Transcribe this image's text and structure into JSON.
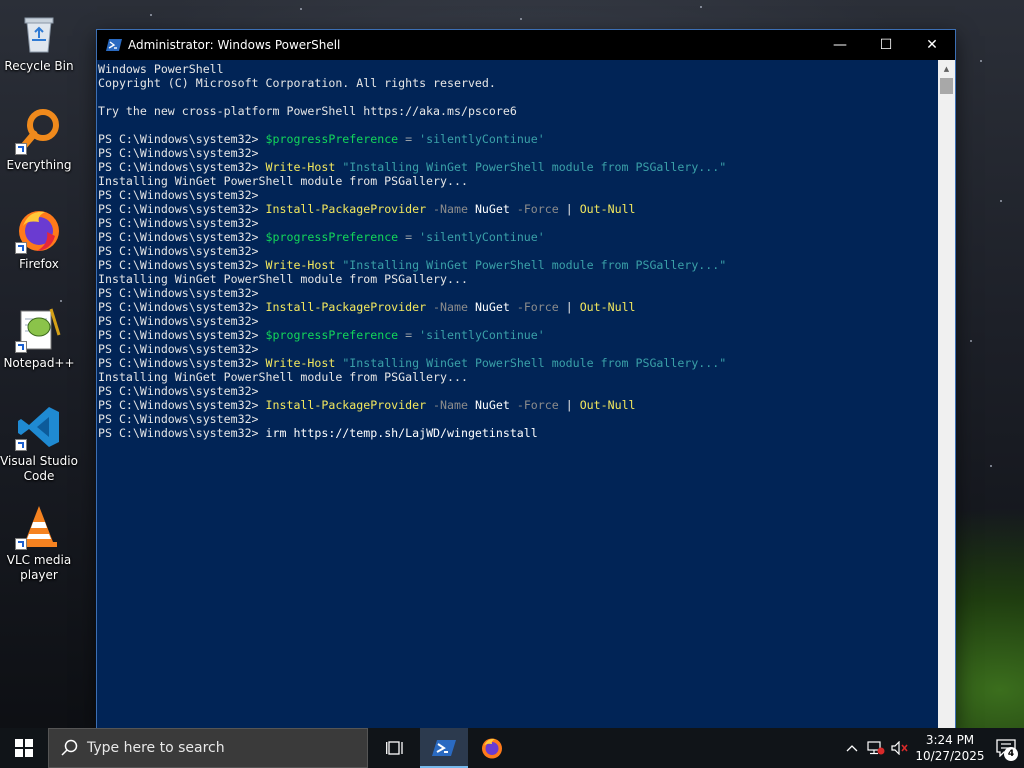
{
  "desktop": {
    "icons": [
      {
        "label": "Recycle Bin",
        "icon": "recycle-bin-icon"
      },
      {
        "label": "Everything",
        "icon": "everything-search-icon"
      },
      {
        "label": "Firefox",
        "icon": "firefox-icon"
      },
      {
        "label": "Notepad++",
        "icon": "notepad-plus-plus-icon"
      },
      {
        "label": "Visual Studio Code",
        "icon": "vscode-icon"
      },
      {
        "label": "VLC media player",
        "icon": "vlc-icon"
      }
    ]
  },
  "window": {
    "title": "Administrator: Windows PowerShell",
    "controls": {
      "minimize": "—",
      "maximize": "☐",
      "close": "✕"
    }
  },
  "console": {
    "lines": [
      [
        [
          "t",
          "Windows PowerShell"
        ]
      ],
      [
        [
          "t",
          "Copyright (C) Microsoft Corporation. All rights reserved."
        ]
      ],
      [],
      [
        [
          "t",
          "Try the new cross-platform PowerShell https://aka.ms/pscore6"
        ]
      ],
      [],
      [
        [
          "t",
          "PS C:\\Windows\\system32> "
        ],
        [
          "var",
          "$progressPreference"
        ],
        [
          "op",
          " = "
        ],
        [
          "str",
          "'silentlyContinue'"
        ]
      ],
      [
        [
          "t",
          "PS C:\\Windows\\system32>"
        ]
      ],
      [
        [
          "t",
          "PS C:\\Windows\\system32> "
        ],
        [
          "cmd",
          "Write-Host"
        ],
        [
          "str",
          " \"Installing WinGet PowerShell module from PSGallery...\""
        ]
      ],
      [
        [
          "t",
          "Installing WinGet PowerShell module from PSGallery..."
        ]
      ],
      [
        [
          "t",
          "PS C:\\Windows\\system32>"
        ]
      ],
      [
        [
          "t",
          "PS C:\\Windows\\system32> "
        ],
        [
          "cmd",
          "Install-PackageProvider"
        ],
        [
          "param",
          " -Name"
        ],
        [
          "white",
          " NuGet"
        ],
        [
          "param",
          " -Force"
        ],
        [
          "t",
          " | "
        ],
        [
          "cmd",
          "Out-Null"
        ]
      ],
      [
        [
          "t",
          "PS C:\\Windows\\system32>"
        ]
      ],
      [
        [
          "t",
          "PS C:\\Windows\\system32> "
        ],
        [
          "var",
          "$progressPreference"
        ],
        [
          "op",
          " = "
        ],
        [
          "str",
          "'silentlyContinue'"
        ]
      ],
      [
        [
          "t",
          "PS C:\\Windows\\system32>"
        ]
      ],
      [
        [
          "t",
          "PS C:\\Windows\\system32> "
        ],
        [
          "cmd",
          "Write-Host"
        ],
        [
          "str",
          " \"Installing WinGet PowerShell module from PSGallery...\""
        ]
      ],
      [
        [
          "t",
          "Installing WinGet PowerShell module from PSGallery..."
        ]
      ],
      [
        [
          "t",
          "PS C:\\Windows\\system32>"
        ]
      ],
      [
        [
          "t",
          "PS C:\\Windows\\system32> "
        ],
        [
          "cmd",
          "Install-PackageProvider"
        ],
        [
          "param",
          " -Name"
        ],
        [
          "white",
          " NuGet"
        ],
        [
          "param",
          " -Force"
        ],
        [
          "t",
          " | "
        ],
        [
          "cmd",
          "Out-Null"
        ]
      ],
      [
        [
          "t",
          "PS C:\\Windows\\system32>"
        ]
      ],
      [
        [
          "t",
          "PS C:\\Windows\\system32> "
        ],
        [
          "var",
          "$progressPreference"
        ],
        [
          "op",
          " = "
        ],
        [
          "str",
          "'silentlyContinue'"
        ]
      ],
      [
        [
          "t",
          "PS C:\\Windows\\system32>"
        ]
      ],
      [
        [
          "t",
          "PS C:\\Windows\\system32> "
        ],
        [
          "cmd",
          "Write-Host"
        ],
        [
          "str",
          " \"Installing WinGet PowerShell module from PSGallery...\""
        ]
      ],
      [
        [
          "t",
          "Installing WinGet PowerShell module from PSGallery..."
        ]
      ],
      [
        [
          "t",
          "PS C:\\Windows\\system32>"
        ]
      ],
      [
        [
          "t",
          "PS C:\\Windows\\system32> "
        ],
        [
          "cmd",
          "Install-PackageProvider"
        ],
        [
          "param",
          " -Name"
        ],
        [
          "white",
          " NuGet"
        ],
        [
          "param",
          " -Force"
        ],
        [
          "t",
          " | "
        ],
        [
          "cmd",
          "Out-Null"
        ]
      ],
      [
        [
          "t",
          "PS C:\\Windows\\system32>"
        ]
      ],
      [
        [
          "t",
          "PS C:\\Windows\\system32> "
        ],
        [
          "white",
          "irm https://temp.sh/LajWD/wingetinstall"
        ]
      ]
    ]
  },
  "taskbar": {
    "search_placeholder": "Type here to search",
    "apps": [
      {
        "name": "task-view-button",
        "icon": "task-view-icon",
        "active": false
      },
      {
        "name": "powershell-taskbar-button",
        "icon": "powershell-icon",
        "active": true
      },
      {
        "name": "firefox-taskbar-button",
        "icon": "firefox-icon",
        "active": false
      }
    ],
    "clock": {
      "time": "3:24 PM",
      "date": "10/27/2025"
    },
    "notification_count": "4"
  },
  "colors": {
    "console_bg": "#012456",
    "variable": "#13d65a",
    "string": "#3aa0a8",
    "command": "#f2e75e",
    "parameter": "#8c8c8c"
  }
}
